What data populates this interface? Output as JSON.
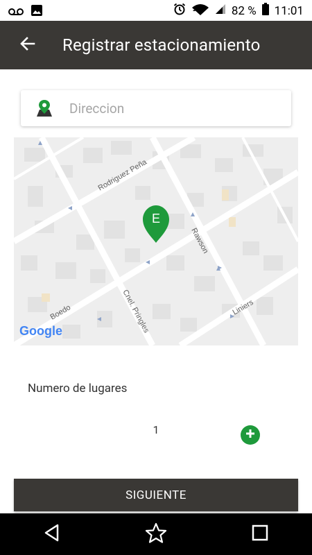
{
  "status_bar": {
    "battery": "82 %",
    "time": "11:01",
    "icons": [
      "voicemail-icon",
      "image-icon",
      "alarm-icon",
      "wifi-icon",
      "signal-icon",
      "battery-icon"
    ]
  },
  "app_bar": {
    "title": "Registrar estacionamiento",
    "back_icon": "arrow-back-icon"
  },
  "address": {
    "placeholder": "Direccion",
    "icon": "map-pin-icon"
  },
  "map": {
    "marker_label": "E",
    "street_labels": {
      "rodriguez_pena": "Rodriguez Peña",
      "rawson": "Rawson",
      "pringles": "Cnel. Pringles",
      "boedo": "Boedo",
      "liniers": "Liniers"
    },
    "logo": "Google",
    "colors": {
      "marker": "#1e9a3b"
    }
  },
  "quantity": {
    "label": "Numero de lugares",
    "value": "1",
    "add_icon": "plus-circle-icon"
  },
  "next_button": {
    "label": "SIGUIENTE"
  },
  "nav_bar": {
    "icons": [
      "back-triangle-icon",
      "star-icon",
      "square-icon"
    ]
  },
  "colors": {
    "app_bar": "#3a3835",
    "accent_green": "#1e9a3b",
    "button": "#3a3835"
  }
}
